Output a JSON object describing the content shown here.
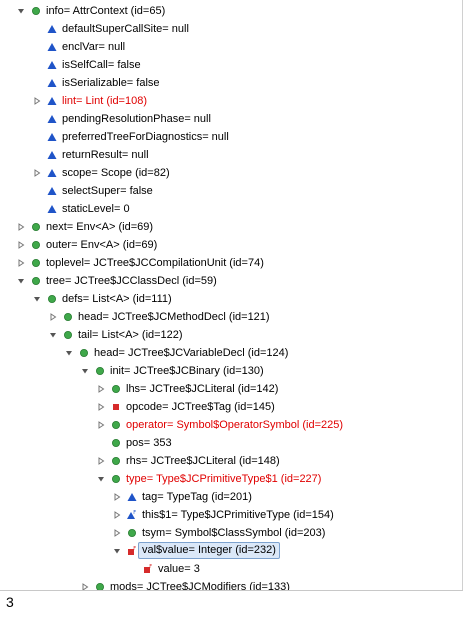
{
  "tree": {
    "rows": [
      {
        "label": "info= AttrContext  (id=65)",
        "indent": 0,
        "state": "open",
        "icon": "green-circle-icon"
      },
      {
        "label": "defaultSuperCallSite= null",
        "indent": 1,
        "state": "none",
        "icon": "blue-triangle-icon"
      },
      {
        "label": "enclVar= null",
        "indent": 1,
        "state": "none",
        "icon": "blue-triangle-icon"
      },
      {
        "label": "isSelfCall= false",
        "indent": 1,
        "state": "none",
        "icon": "blue-triangle-icon"
      },
      {
        "label": "isSerializable= false",
        "indent": 1,
        "state": "none",
        "icon": "blue-triangle-icon"
      },
      {
        "label": "lint= Lint  (id=108)",
        "indent": 1,
        "state": "closed",
        "icon": "blue-triangle-icon",
        "changed": true
      },
      {
        "label": "pendingResolutionPhase= null",
        "indent": 1,
        "state": "none",
        "icon": "blue-triangle-icon"
      },
      {
        "label": "preferredTreeForDiagnostics= null",
        "indent": 1,
        "state": "none",
        "icon": "blue-triangle-icon"
      },
      {
        "label": "returnResult= null",
        "indent": 1,
        "state": "none",
        "icon": "blue-triangle-icon"
      },
      {
        "label": "scope= Scope  (id=82)",
        "indent": 1,
        "state": "closed",
        "icon": "blue-triangle-icon"
      },
      {
        "label": "selectSuper= false",
        "indent": 1,
        "state": "none",
        "icon": "blue-triangle-icon"
      },
      {
        "label": "staticLevel= 0",
        "indent": 1,
        "state": "none",
        "icon": "blue-triangle-icon"
      },
      {
        "label": "next= Env<A>  (id=69)",
        "indent": 0,
        "state": "closed",
        "icon": "green-circle-icon"
      },
      {
        "label": "outer= Env<A>  (id=69)",
        "indent": 0,
        "state": "closed",
        "icon": "green-circle-icon"
      },
      {
        "label": "toplevel= JCTree$JCCompilationUnit  (id=74)",
        "indent": 0,
        "state": "closed",
        "icon": "green-circle-icon"
      },
      {
        "label": "tree= JCTree$JCClassDecl  (id=59)",
        "indent": 0,
        "state": "open",
        "icon": "green-circle-icon"
      },
      {
        "label": "defs= List<A>  (id=111)",
        "indent": 1,
        "state": "open",
        "icon": "green-circle-icon"
      },
      {
        "label": "head= JCTree$JCMethodDecl  (id=121)",
        "indent": 2,
        "state": "closed",
        "icon": "green-circle-icon"
      },
      {
        "label": "tail= List<A>  (id=122)",
        "indent": 2,
        "state": "open",
        "icon": "green-circle-icon"
      },
      {
        "label": "head= JCTree$JCVariableDecl  (id=124)",
        "indent": 3,
        "state": "open",
        "icon": "green-circle-icon"
      },
      {
        "label": "init= JCTree$JCBinary  (id=130)",
        "indent": 4,
        "state": "open",
        "icon": "green-circle-icon"
      },
      {
        "label": "lhs= JCTree$JCLiteral  (id=142)",
        "indent": 5,
        "state": "closed",
        "icon": "green-circle-icon"
      },
      {
        "label": "opcode= JCTree$Tag  (id=145)",
        "indent": 5,
        "state": "closed",
        "icon": "red-square-icon"
      },
      {
        "label": "operator= Symbol$OperatorSymbol  (id=225)",
        "indent": 5,
        "state": "closed",
        "icon": "green-circle-icon",
        "changed": true
      },
      {
        "label": "pos= 353",
        "indent": 5,
        "state": "none",
        "icon": "green-circle-icon"
      },
      {
        "label": "rhs= JCTree$JCLiteral  (id=148)",
        "indent": 5,
        "state": "closed",
        "icon": "green-circle-icon"
      },
      {
        "label": "type= Type$JCPrimitiveType$1  (id=227)",
        "indent": 5,
        "state": "open",
        "icon": "green-circle-icon",
        "changed": true
      },
      {
        "label": "tag= TypeTag  (id=201)",
        "indent": 6,
        "state": "closed",
        "icon": "blue-triangle-icon"
      },
      {
        "label": "this$1= Type$JCPrimitiveType  (id=154)",
        "indent": 6,
        "state": "closed",
        "icon": "blue-triangle-final-icon"
      },
      {
        "label": "tsym= Symbol$ClassSymbol  (id=203)",
        "indent": 6,
        "state": "closed",
        "icon": "green-circle-icon"
      },
      {
        "label": "val$value= Integer  (id=232)",
        "indent": 6,
        "state": "open",
        "icon": "red-square-final-icon",
        "selected": true
      },
      {
        "label": "value= 3",
        "indent": 7,
        "state": "none",
        "icon": "red-square-final-icon"
      },
      {
        "label": "mods= JCTree$JCModifiers  (id=133)",
        "indent": 4,
        "state": "closed",
        "icon": "green-circle-icon"
      }
    ]
  },
  "detail": {
    "text": "3"
  },
  "colors": {
    "changed": "#e00000",
    "green": "#3fa84a",
    "blue": "#1f54c8",
    "red": "#d62b2b",
    "selection": "#dbe8f8"
  }
}
